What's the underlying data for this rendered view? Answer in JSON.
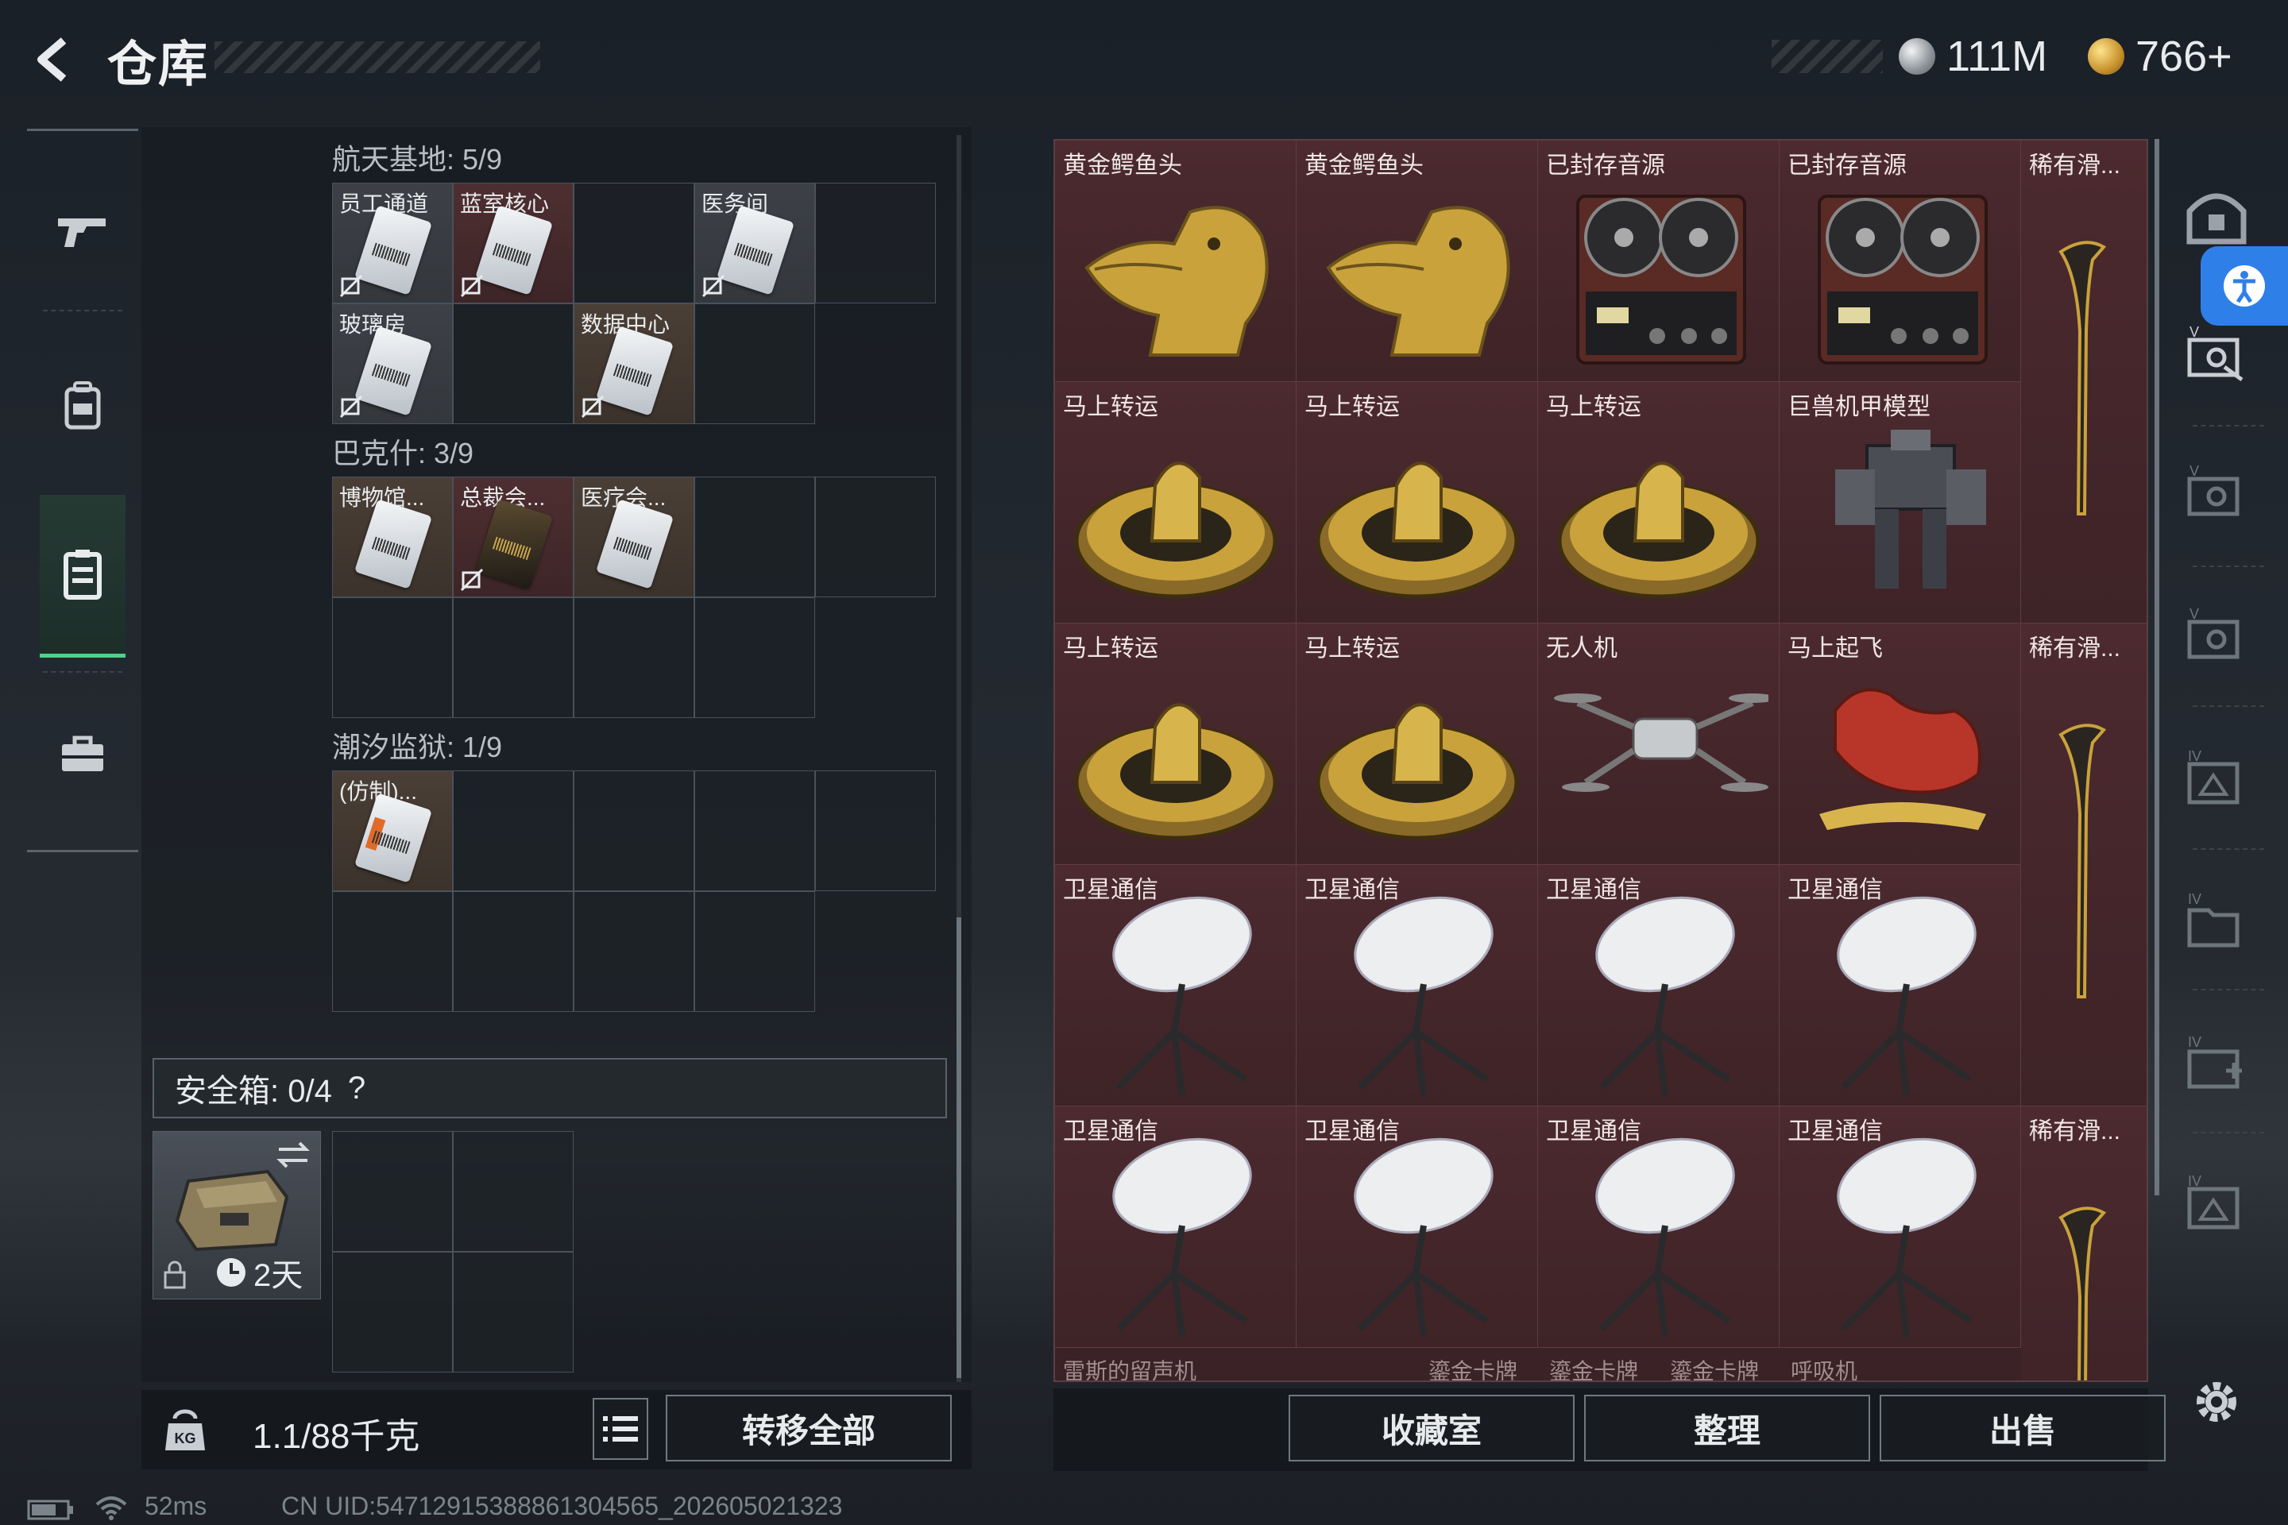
{
  "header": {
    "title": "仓库",
    "back_icon": "back-arrow-icon",
    "currency_silver": "111M",
    "currency_gold": "766+"
  },
  "left_nav": {
    "items": [
      {
        "name": "weapon-tab",
        "icon": "gun-icon"
      },
      {
        "name": "backpack-tab",
        "icon": "backpack-icon"
      },
      {
        "name": "keycard-tab",
        "icon": "keycard-case-icon",
        "active": true
      },
      {
        "name": "toolbox-tab",
        "icon": "briefcase-icon"
      }
    ]
  },
  "keycards": {
    "groups": [
      {
        "title": "航天基地: 5/9",
        "cells": [
          "员工通道",
          "蓝室核心",
          "",
          "医务间",
          "",
          "玻璃房",
          "",
          "数据中心",
          "",
          ""
        ]
      },
      {
        "title": "巴克什: 3/9",
        "cells": [
          "博物馆...",
          "总裁会...",
          "医疗会..."
        ]
      },
      {
        "title": "潮汐监狱: 1/9",
        "cells": [
          "(仿制)..."
        ]
      }
    ]
  },
  "safebox": {
    "label": "安全箱: 0/4",
    "help": "?",
    "timer": "2天"
  },
  "bottom_left": {
    "weight": "1.1/88千克",
    "transfer_all": "转移全部"
  },
  "storage": {
    "rows": [
      [
        "黄金鳄鱼头",
        "黄金鳄鱼头",
        "已封存音源",
        "已封存音源",
        "稀有滑..."
      ],
      [
        "马上转运",
        "马上转运",
        "马上转运",
        "巨兽机甲模型",
        ""
      ],
      [
        "马上转运",
        "马上转运",
        "无人机",
        "马上起飞",
        "稀有滑..."
      ],
      [
        "卫星通信",
        "卫星通信",
        "卫星通信",
        "卫星通信",
        ""
      ],
      [
        "卫星通信",
        "卫星通信",
        "卫星通信",
        "卫星通信",
        "稀有滑..."
      ]
    ],
    "next_row": [
      "雷斯的留声机",
      "鎏金卡牌",
      "鎏金卡牌",
      "鎏金卡牌",
      "呼吸机"
    ]
  },
  "bottom_right": {
    "collection": "收藏室",
    "sort": "整理",
    "sell": "出售"
  },
  "status": {
    "ping": "52ms",
    "uid": "CN UID:5471291538886130456 5_202605021323",
    "uid_text": "CN UID:54712915388861304565_202605021323"
  },
  "colors": {
    "accent_green": "#4fd08c",
    "item_bg": "#4c2a2f",
    "accessibility_blue": "#2f7fe8"
  }
}
